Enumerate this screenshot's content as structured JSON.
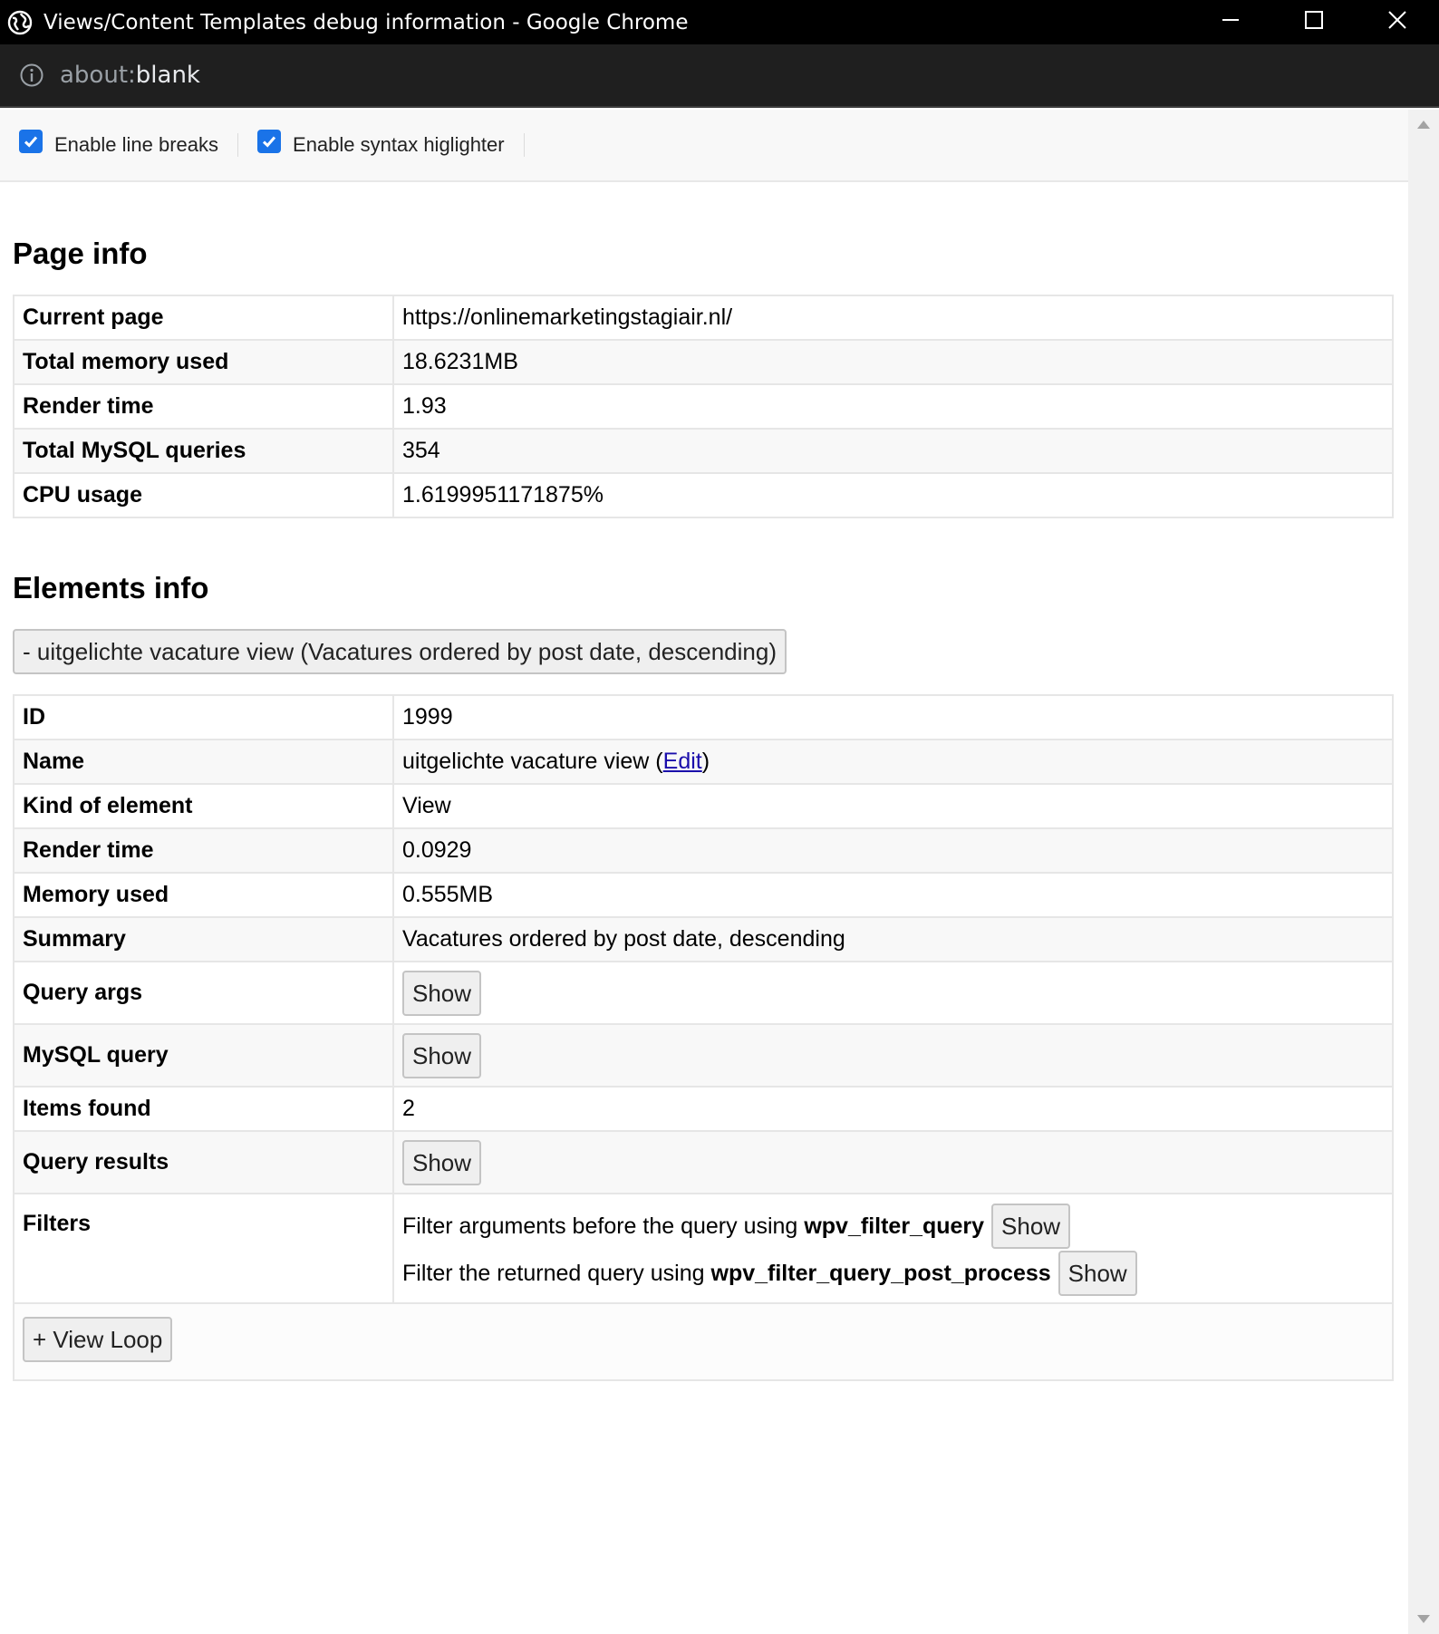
{
  "window": {
    "title": "Views/Content Templates debug information - Google Chrome",
    "icons": {
      "app": "globe-icon",
      "minimize": "minimize-icon",
      "maximize": "maximize-icon",
      "close": "close-icon"
    }
  },
  "address_bar": {
    "scheme": "about:",
    "host": "blank",
    "icon": "info-icon"
  },
  "toolbar": {
    "line_breaks_label": "Enable line breaks",
    "line_breaks_checked": true,
    "syntax_label": "Enable syntax higlighter",
    "syntax_checked": true
  },
  "page_info": {
    "heading": "Page info",
    "rows": [
      {
        "key": "Current page",
        "value": "https://onlinemarketingstagiair.nl/"
      },
      {
        "key": "Total memory used",
        "value": "18.6231MB"
      },
      {
        "key": "Render time",
        "value": "1.93"
      },
      {
        "key": "Total MySQL queries",
        "value": "354"
      },
      {
        "key": "CPU usage",
        "value": "1.6199951171875%"
      }
    ]
  },
  "elements_info": {
    "heading": "Elements info",
    "collapse_button": "- uitgelichte vacature view (Vacatures ordered by post date, descending)",
    "rows": {
      "id_key": "ID",
      "id_value": "1999",
      "name_key": "Name",
      "name_value": "uitgelichte vacature view (",
      "name_edit": "Edit",
      "name_close": ")",
      "kind_key": "Kind of element",
      "kind_value": "View",
      "render_key": "Render time",
      "render_value": "0.0929",
      "memory_key": "Memory used",
      "memory_value": "0.555MB",
      "summary_key": "Summary",
      "summary_value": "Vacatures ordered by post date, descending",
      "query_args_key": "Query args",
      "query_args_button": "Show",
      "mysql_key": "MySQL query",
      "mysql_button": "Show",
      "items_key": "Items found",
      "items_value": "2",
      "results_key": "Query results",
      "results_button": "Show",
      "filters_key": "Filters",
      "filter1_text": "Filter arguments before the query using",
      "filter1_hook": "wpv_filter_query",
      "filter1_button": "Show",
      "filter2_text": "Filter the returned query using",
      "filter2_hook": "wpv_filter_query_post_process",
      "filter2_button": "Show"
    },
    "view_loop_button": "+ View Loop"
  },
  "colors": {
    "checkbox": "#1a73e8",
    "titlebar": "#000000",
    "addressbar": "#1f1f1f",
    "link": "#1a0dab"
  }
}
